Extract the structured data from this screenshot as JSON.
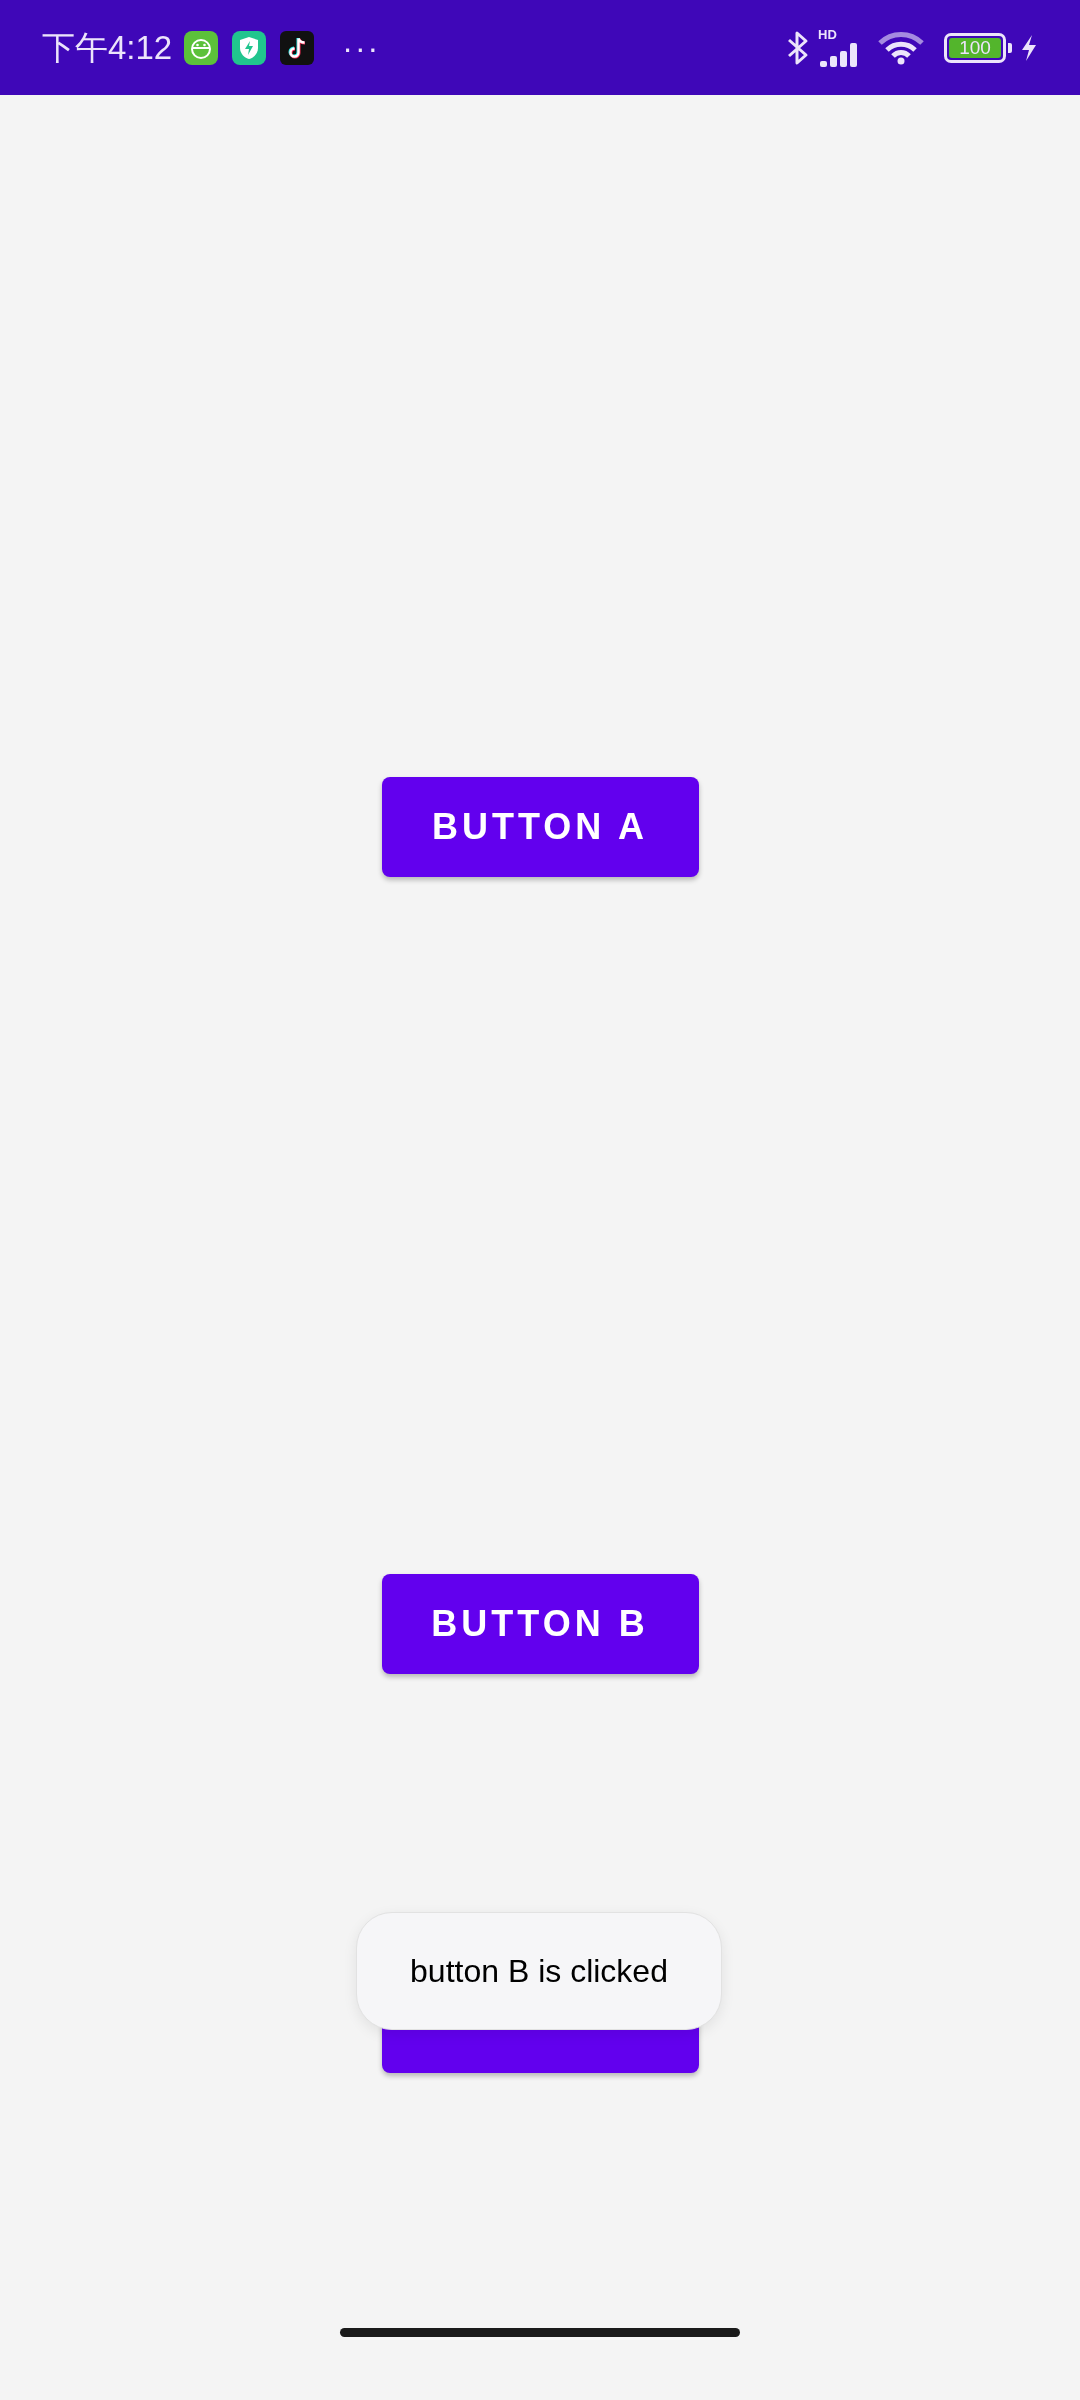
{
  "status_bar": {
    "time": "下午4:12",
    "more": "···",
    "network": "HD",
    "battery": "100"
  },
  "buttons": [
    {
      "kind": "labeled",
      "label": "BUTTON A"
    },
    {
      "kind": "labeled",
      "label": "BUTTON B"
    },
    {
      "kind": "covered"
    }
  ],
  "toast": {
    "message": "button B is clicked"
  }
}
